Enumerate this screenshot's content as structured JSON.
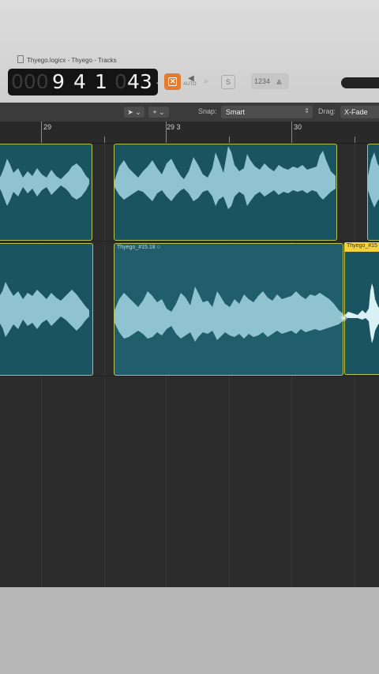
{
  "window": {
    "title": "Thyego.logicx - Thyego - Tracks"
  },
  "lcd": {
    "dim1": "000",
    "bar": "9",
    "beat": "4",
    "div": "1",
    "dim2": "0",
    "tick": "43"
  },
  "toolbar": {
    "auto_label": "AUTO",
    "s_label": "S",
    "count_label": "1234",
    "tuner_glyph": "⩓"
  },
  "control_bar": {
    "pointer_tool": "➤ ⌄",
    "plus_tool": "+ ⌄",
    "snap_label": "Snap:",
    "snap_value": "Smart",
    "drag_label": "Drag:",
    "drag_value": "X-Fade"
  },
  "ruler": {
    "bars": [
      "29",
      "29 3",
      "30"
    ]
  },
  "regions": {
    "lower_mid_name": "Thyego_#15.18",
    "lower_right_name": "Thyego_#15"
  },
  "colors": {
    "region_fill": "#1a5461",
    "region_border": "#b6c456",
    "waveform": "#8fc3cf",
    "selection": "#f3d23c"
  },
  "icons": [
    "document-icon",
    "chevron-down-icon",
    "cycle-x-icon",
    "speaker-icon",
    "magnifier-icon",
    "solo-icon",
    "tuner-icon",
    "pointer-tool-icon",
    "plus-tool-icon",
    "crossfade-cursor-icon"
  ]
}
